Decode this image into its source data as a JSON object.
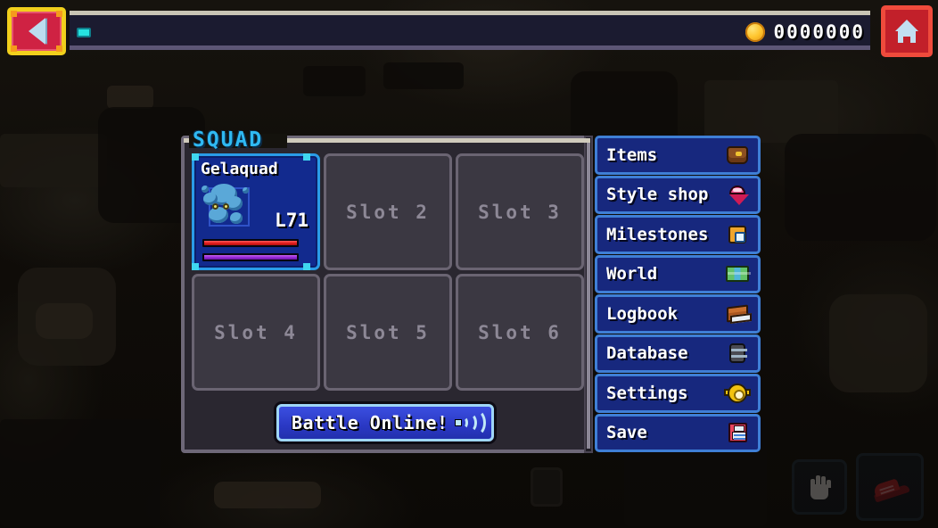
{
  "topbar": {
    "back_button": {
      "icon": "arrow-left-icon",
      "label": ""
    },
    "home_button": {
      "icon": "home-icon",
      "label": ""
    },
    "currency": {
      "icon": "coin-icon",
      "amount": "0000000"
    },
    "xp_pip": {
      "icon": "progress-pip-icon"
    }
  },
  "squad": {
    "title": "SQUAD",
    "slots": [
      {
        "filled": true,
        "name": "Gelaquad",
        "level": "L71",
        "sprite": "gelaquad-sprite",
        "hp_percent": 100,
        "mp_percent": 100,
        "hp_color": "#e01b1b",
        "mp_color": "#9327d6",
        "selected": true
      },
      {
        "filled": false,
        "name": "Slot 2"
      },
      {
        "filled": false,
        "name": "Slot 3"
      },
      {
        "filled": false,
        "name": "Slot 4"
      },
      {
        "filled": false,
        "name": "Slot 5"
      },
      {
        "filled": false,
        "name": "Slot 6"
      }
    ],
    "battle_button": {
      "label": "Battle Online!",
      "icon": "wifi-signal-icon"
    }
  },
  "menu": {
    "items": [
      {
        "label": "Items",
        "icon": "bag-icon"
      },
      {
        "label": "Style shop",
        "icon": "gem-icon"
      },
      {
        "label": "Milestones",
        "icon": "medal-icon"
      },
      {
        "label": "World",
        "icon": "map-icon"
      },
      {
        "label": "Logbook",
        "icon": "book-icon"
      },
      {
        "label": "Database",
        "icon": "database-icon"
      },
      {
        "label": "Settings",
        "icon": "gear-icon"
      },
      {
        "label": "Save",
        "icon": "floppy-disk-icon"
      }
    ]
  },
  "controls": {
    "grab_button": {
      "icon": "hand-icon",
      "label": ""
    },
    "dash_button": {
      "icon": "running-shoe-icon",
      "label": ""
    }
  },
  "theme": {
    "accent_cyan": "#2fb9f2",
    "menu_blue": "#17287e",
    "menu_border": "#3f7fd6",
    "panel_bg": "#2a2730",
    "panel_border": "#6e6878",
    "slot_bg": "#3b3842",
    "card_blue": "#122a8e",
    "gold": "#ffc62e",
    "danger_red": "#c2202a"
  }
}
